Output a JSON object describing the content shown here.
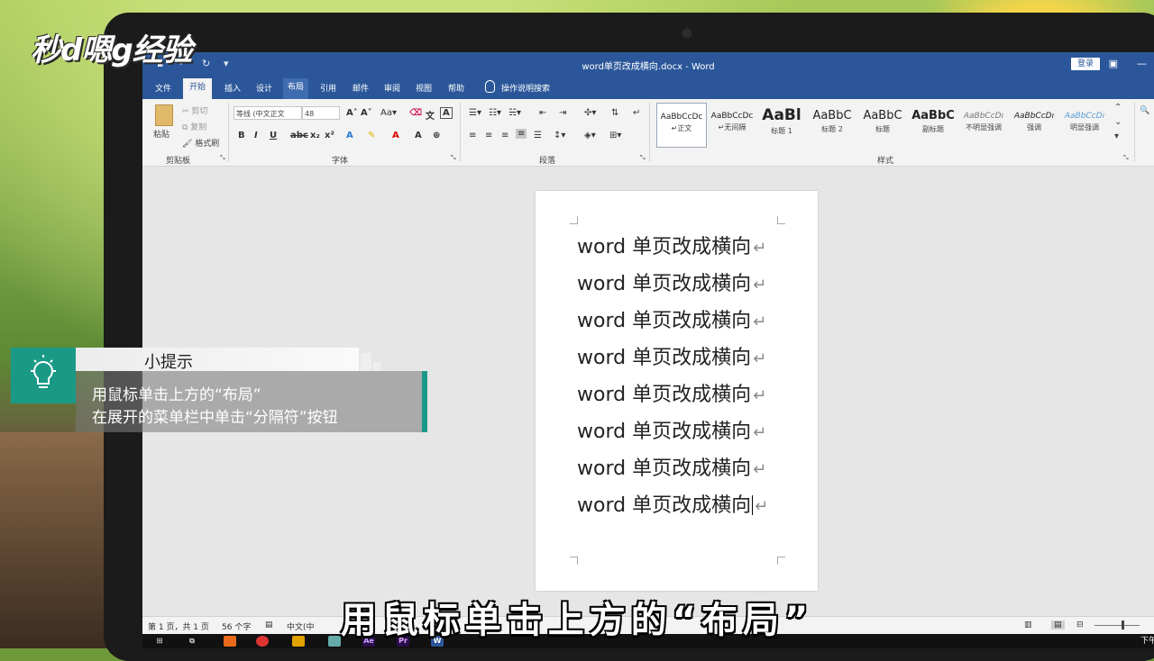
{
  "watermark": "秒d嗯g经验",
  "window": {
    "title": "word单页改成横向.docx - Word",
    "login": "登录"
  },
  "tabs": [
    "文件",
    "开始",
    "插入",
    "设计",
    "布局",
    "引用",
    "邮件",
    "审阅",
    "视图",
    "帮助",
    "操作说明搜索"
  ],
  "ribbon": {
    "clipboard": {
      "paste": "粘贴",
      "cut": "剪切",
      "copy": "复制",
      "format_painter": "格式刷",
      "label": "剪贴板"
    },
    "font": {
      "font_name": "等线 (中文正文",
      "font_size": "48",
      "label": "字体"
    },
    "paragraph": {
      "label": "段落"
    },
    "styles": {
      "label": "样式",
      "items": [
        {
          "sample": "AaBbCcDc",
          "name": "↵正文"
        },
        {
          "sample": "AaBbCcDc",
          "name": "↵无间隔"
        },
        {
          "sample": "AaBl",
          "name": "标题 1"
        },
        {
          "sample": "AaBbC",
          "name": "标题 2"
        },
        {
          "sample": "AaBbC",
          "name": "标题"
        },
        {
          "sample": "AaBbC",
          "name": "副标题"
        },
        {
          "sample": "AaBbCcDı",
          "name": "不明显强调"
        },
        {
          "sample": "AaBbCcDı",
          "name": "强调"
        },
        {
          "sample": "AaBbCcDı",
          "name": "明显强调"
        }
      ]
    }
  },
  "document": {
    "lines": [
      "word 单页改成横向",
      "word 单页改成横向",
      "word 单页改成横向",
      "word 单页改成横向",
      "word 单页改成横向",
      "word 单页改成横向",
      "word 单页改成横向",
      "word 单页改成横向"
    ],
    "pilcrow": "↵"
  },
  "status": {
    "page": "第 1 页，共 1 页",
    "words": "56 个字",
    "lang": "中文(中",
    "clock": "下午"
  },
  "tip": {
    "title": "小提示",
    "line1": "用鼠标单击上方的“布局”",
    "line2": "在展开的菜单栏中单击“分隔符”按钮"
  },
  "subtitle": "用鼠标单击上方的“布局”",
  "colors": {
    "word_blue": "#2b579a",
    "tip_teal": "#1a9a86"
  }
}
